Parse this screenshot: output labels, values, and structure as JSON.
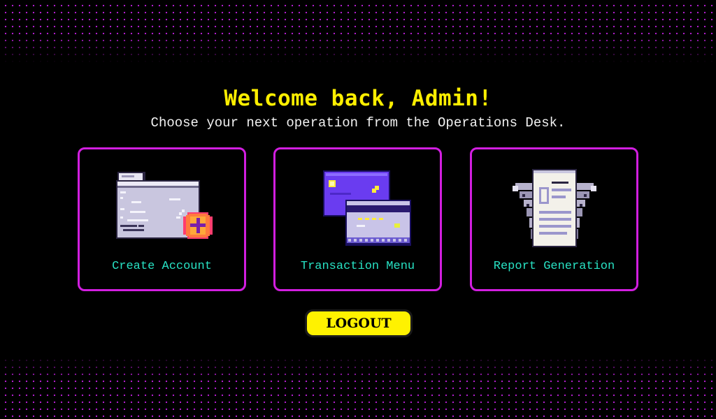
{
  "header": {
    "title": "Welcome back, Admin!",
    "subtitle": "Choose your next operation from the Operations Desk."
  },
  "cards": [
    {
      "label": "Create Account",
      "icon": "folder-add-icon"
    },
    {
      "label": "Transaction Menu",
      "icon": "credit-cards-icon"
    },
    {
      "label": "Report Generation",
      "icon": "report-document-icon"
    }
  ],
  "actions": {
    "logout_label": "LOGOUT"
  },
  "colors": {
    "background": "#000000",
    "accent_title": "#ffef00",
    "card_border": "#d21ee0",
    "card_label": "#28e2c4",
    "logout_button": "#fff200",
    "dot_pattern": "#b81fd6"
  }
}
